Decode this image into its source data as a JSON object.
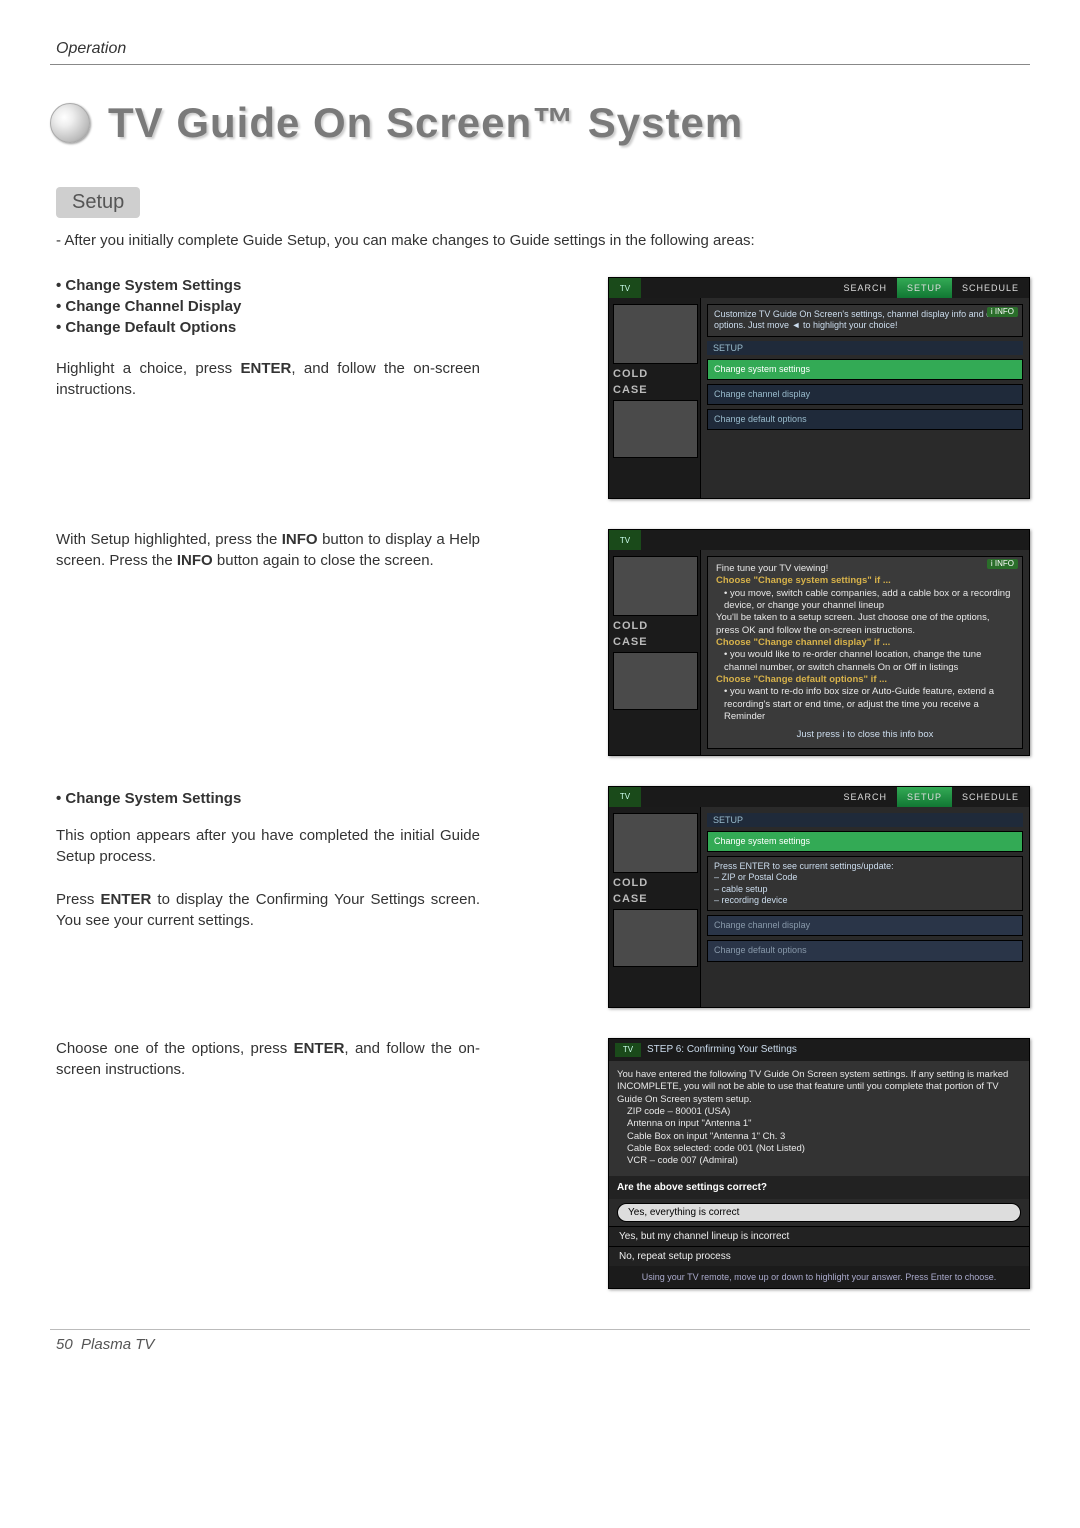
{
  "header": {
    "section": "Operation"
  },
  "title": "TV Guide On Screen™ System",
  "setup": {
    "label": "Setup",
    "intro": "-  After you initially complete Guide Setup, you can make changes to Guide settings in the following areas:",
    "bullets": [
      "• Change System Settings",
      "• Change Channel Display",
      "• Change Default Options"
    ],
    "instr1_pre": "Highlight a choice, press ",
    "instr1_bold": "ENTER",
    "instr1_post": ", and follow the on-screen instructions.",
    "instr2_pre": "With Setup highlighted, press the ",
    "instr2_bold1": "INFO",
    "instr2_mid": " button to display a Help screen. Press the ",
    "instr2_bold2": "INFO",
    "instr2_post": " button again to close the screen.",
    "sub1": "• Change System Settings",
    "sub1_p1": "This option appears after you have completed the initial Guide Setup process.",
    "sub1_p2_pre": "Press ",
    "sub1_p2_bold": "ENTER",
    "sub1_p2_post": " to display the Confirming Your Settings screen. You see your current settings.",
    "sub1_p3_pre": "Choose one of the options, press ",
    "sub1_p3_bold": "ENTER",
    "sub1_p3_post": ", and follow the on-screen instructions."
  },
  "shot1": {
    "logo": "TV",
    "tabs": {
      "search": "SEARCH",
      "setup": "SETUP",
      "schedule": "SCHEDULE"
    },
    "badge": "i INFO",
    "hint": "Customize TV Guide On Screen's settings, channel display info and default options. Just move ◄ to highlight your choice!",
    "section": "SETUP",
    "items": {
      "a": "Change system settings",
      "b": "Change channel display",
      "c": "Change default options"
    },
    "show1": "COLD",
    "show2": "CASE"
  },
  "shot2": {
    "logo": "TV",
    "badge": "i INFO",
    "line0": "Fine tune your TV viewing!",
    "h1": "Choose \"Change system settings\" if ...",
    "h1a": "• you move, switch cable companies, add a cable box or a recording device, or change your channel lineup",
    "h1b": "You'll be taken to a setup screen. Just choose one of the options, press OK and follow the on-screen instructions.",
    "h2": "Choose \"Change channel display\" if ...",
    "h2a": "• you would like to re-order channel location, change the tune channel number, or switch channels On or Off in listings",
    "h3": "Choose \"Change default options\" if ...",
    "h3a": "• you want to re-do info box size or Auto-Guide feature, extend a recording's start or end time, or adjust the time you receive a Reminder",
    "closing": "Just press i to close this info box",
    "show1": "COLD",
    "show2": "CASE"
  },
  "shot3": {
    "logo": "TV",
    "tabs": {
      "search": "SEARCH",
      "setup": "SETUP",
      "schedule": "SCHEDULE"
    },
    "section": "SETUP",
    "item_hl": "Change system settings",
    "hint": "Press ENTER to see current settings/update:",
    "hint_a": "– ZIP or Postal Code",
    "hint_b": "– cable setup",
    "hint_c": "– recording device",
    "item_b": "Change channel display",
    "item_c": "Change default options",
    "show1": "COLD",
    "show2": "CASE"
  },
  "dialog": {
    "logo": "TV",
    "title": "STEP 6: Confirming Your Settings",
    "body_intro": "You have entered the following TV Guide On Screen system settings. If any setting is marked INCOMPLETE, you will not be able to use that feature until you complete that portion of TV Guide On Screen system setup.",
    "lines": {
      "a": "ZIP code – 80001 (USA)",
      "b": "Antenna on input \"Antenna 1\"",
      "c": "Cable Box on input \"Antenna 1\" Ch. 3",
      "d": "Cable Box selected: code 001 (Not Listed)",
      "e": "VCR – code 007 (Admiral)"
    },
    "question": "Are the above settings correct?",
    "options": {
      "a": "Yes, everything is correct",
      "b": "Yes, but my channel lineup is incorrect",
      "c": "No, repeat setup process"
    },
    "footer": "Using your TV remote, move up or down to highlight your answer.  Press Enter to choose."
  },
  "footer": {
    "page": "50",
    "label": "Plasma TV"
  }
}
